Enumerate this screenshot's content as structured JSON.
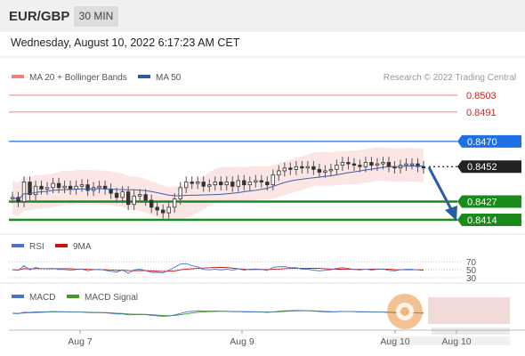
{
  "header": {
    "symbol": "EUR/GBP",
    "interval": "30 MIN"
  },
  "datetime": "Wednesday, August 10, 2022 6:17:23 AM CET",
  "legend": {
    "ma20_label": "MA 20 + Bollinger Bands",
    "ma50_label": "MA 50",
    "ma20_color": "#f08080",
    "ma50_color": "#2f5b9a",
    "credit": "Research © 2022 Trading Central"
  },
  "rsi_legend": {
    "rsi": "RSI",
    "ma": "9MA",
    "rsi_color": "#4a73c9",
    "ma_color": "#cc1111"
  },
  "macd_legend": {
    "macd": "MACD",
    "signal": "MACD Signal",
    "macd_color": "#4a73c9",
    "signal_color": "#449922"
  },
  "chart_data": {
    "type": "line",
    "price_range": [
      0.8408,
      0.8512
    ],
    "levels": [
      {
        "label": "0.8503",
        "value": 0.8503,
        "kind": "resistance",
        "color": "#f08080"
      },
      {
        "label": "0.8491",
        "value": 0.8491,
        "kind": "resistance",
        "color": "#f08080"
      },
      {
        "label": "0.8470",
        "value": 0.847,
        "kind": "pivot",
        "color": "#1f6fe5"
      },
      {
        "label": "0.8452",
        "value": 0.8452,
        "kind": "last",
        "color": "#222222"
      },
      {
        "label": "0.8427",
        "value": 0.8427,
        "kind": "support",
        "color": "#1a8a1a"
      },
      {
        "label": "0.8414",
        "value": 0.8414,
        "kind": "support",
        "color": "#1a8a1a"
      }
    ],
    "forecast_arrow": {
      "from": 0.8452,
      "to": 0.8414,
      "color": "#2a5da8"
    },
    "x_labels": [
      "Aug 7",
      "Aug 9",
      "Aug 10",
      "Aug 10"
    ],
    "rsi_levels": [
      "70",
      "50",
      "30"
    ],
    "price_series": [
      0.843,
      0.8427,
      0.8441,
      0.8432,
      0.8438,
      0.8436,
      0.8437,
      0.844,
      0.8437,
      0.8438,
      0.8436,
      0.8438,
      0.8439,
      0.8435,
      0.8437,
      0.8438,
      0.8436,
      0.8433,
      0.843,
      0.8434,
      0.8425,
      0.8431,
      0.8432,
      0.8428,
      0.8423,
      0.8421,
      0.8419,
      0.8423,
      0.8429,
      0.8437,
      0.8441,
      0.844,
      0.8441,
      0.8438,
      0.8439,
      0.8441,
      0.8439,
      0.8441,
      0.8438,
      0.8442,
      0.8439,
      0.8441,
      0.8442,
      0.8441,
      0.8439,
      0.8446,
      0.8449,
      0.8451,
      0.845,
      0.8452,
      0.8451,
      0.8452,
      0.845,
      0.8448,
      0.8449,
      0.845,
      0.8453,
      0.8455,
      0.8454,
      0.8453,
      0.8452,
      0.8455,
      0.8453,
      0.8454,
      0.8455,
      0.8452,
      0.8451,
      0.8453,
      0.8454,
      0.8454,
      0.8452,
      0.8451
    ]
  }
}
